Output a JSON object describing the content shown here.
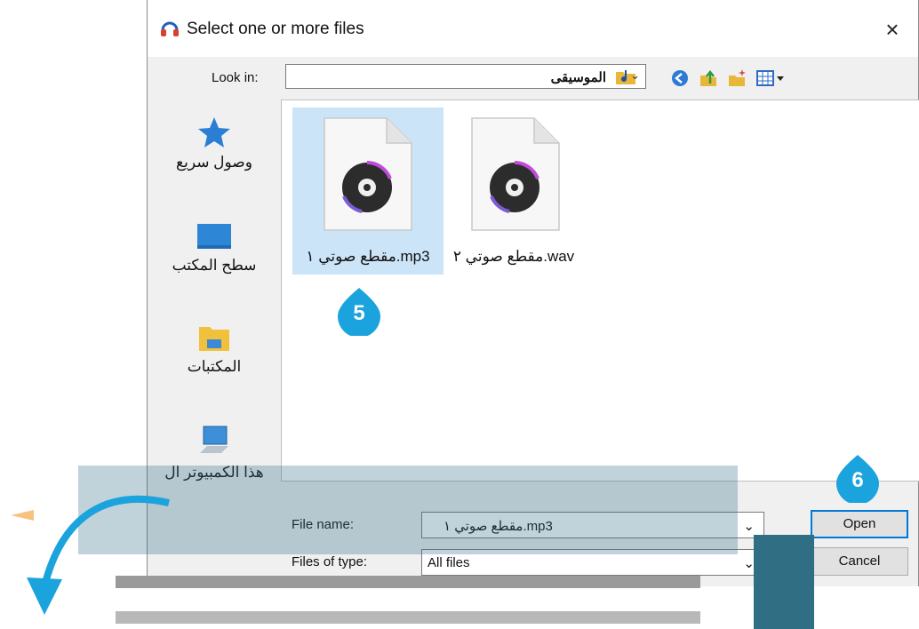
{
  "dialog": {
    "title": "Select one or more files",
    "close_glyph": "×",
    "app_icon": "headphones-icon"
  },
  "lookin": {
    "label": "Look in:",
    "value": "الموسيقى"
  },
  "toolbar": {
    "icons": [
      "back-icon",
      "up-folder-icon",
      "new-folder-icon",
      "view-menu-icon"
    ]
  },
  "sidebar": {
    "items": [
      {
        "label": "وصول سريع",
        "icon": "star-icon"
      },
      {
        "label": "سطح المكتب",
        "icon": "desktop-icon"
      },
      {
        "label": "المكتبات",
        "icon": "libraries-icon"
      },
      {
        "label": "هذا الكمبيوتر ال شخصي",
        "icon": "computer-icon"
      },
      {
        "label": "",
        "icon": "network-icon"
      }
    ]
  },
  "files": [
    {
      "label": "مقطع صوتي ١.mp3",
      "selected": true
    },
    {
      "label": "مقطع صوتي ٢.wav",
      "selected": false
    }
  ],
  "filename": {
    "label": "File name:",
    "value": "مقطع صوتي ١.mp3"
  },
  "filetype": {
    "label": "Files of type:",
    "value": "All files"
  },
  "buttons": {
    "open": "Open",
    "cancel": "Cancel"
  },
  "badges": {
    "step5": "5",
    "step6": "6"
  },
  "colors": {
    "accent": "#0078d7",
    "badge": "#1aa3dc",
    "selection": "#cce4f7",
    "overlay_teal": "#2f6e83"
  }
}
